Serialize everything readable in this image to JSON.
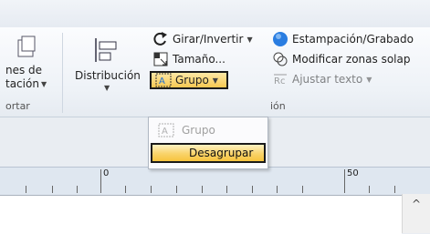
{
  "ribbon": {
    "left_group": {
      "btn_line1": "nes de",
      "btn_line2": "tación",
      "label": "ortar"
    },
    "arrange": {
      "distribution_label": "Distribución",
      "rotate_label": "Girar/Invertir",
      "size_label": "Tamaño...",
      "group_label": "Grupo",
      "group_section_label": "ión"
    },
    "right_group": {
      "stamp_label": "Estampación/Grabado",
      "modify_label": "Modificar zonas solap",
      "adjust_label": "Ajustar texto"
    }
  },
  "dropdown": {
    "items": [
      {
        "label": "Grupo",
        "enabled": false
      },
      {
        "label": "Desagrupar",
        "enabled": true
      }
    ]
  },
  "ruler": {
    "label_zero": "0",
    "label_fifty": "50"
  },
  "scrollbar": {
    "up_arrow": "^"
  },
  "colors": {
    "highlight": "#f7c852",
    "stamp_blue": "#2a7de1"
  }
}
